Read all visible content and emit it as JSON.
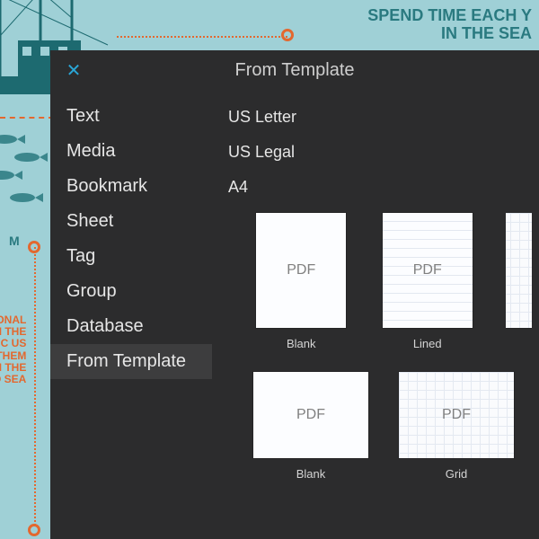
{
  "bg": {
    "right_text_line1": "SPEND TIME EACH Y",
    "right_text_line2": "IN THE SEA",
    "label": "R M",
    "orange_block": "ONAL\nN THE\nIC US\nTHEM\nN THE\nO SEA"
  },
  "panel": {
    "title": "From Template",
    "close_glyph": "✕"
  },
  "sidebar": {
    "items": [
      {
        "label": "Text"
      },
      {
        "label": "Media"
      },
      {
        "label": "Bookmark"
      },
      {
        "label": "Sheet"
      },
      {
        "label": "Tag"
      },
      {
        "label": "Group"
      },
      {
        "label": "Database"
      },
      {
        "label": "From Template"
      }
    ],
    "selected_index": 7
  },
  "content": {
    "sections": [
      {
        "label": "US Letter"
      },
      {
        "label": "US Legal"
      },
      {
        "label": "A4"
      }
    ],
    "pdf_badge": "PDF",
    "row1": [
      {
        "name": "Blank",
        "style": "blank"
      },
      {
        "name": "Lined",
        "style": "lined"
      },
      {
        "name": "",
        "style": "grid"
      }
    ],
    "row2": [
      {
        "name": "Blank",
        "style": "blank"
      },
      {
        "name": "Grid",
        "style": "grid"
      }
    ]
  }
}
